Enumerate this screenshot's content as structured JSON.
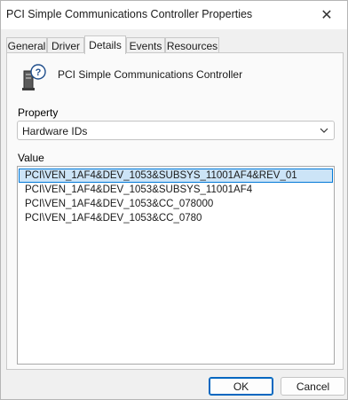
{
  "window": {
    "title": "PCI Simple Communications Controller Properties",
    "close_glyph": "✕"
  },
  "tabs": [
    {
      "label": "General",
      "active": false
    },
    {
      "label": "Driver",
      "active": false
    },
    {
      "label": "Details",
      "active": true
    },
    {
      "label": "Events",
      "active": false
    },
    {
      "label": "Resources",
      "active": false
    }
  ],
  "device": {
    "icon": "unknown-device-icon",
    "name": "PCI Simple Communications Controller"
  },
  "property": {
    "label": "Property",
    "selected": "Hardware IDs"
  },
  "value": {
    "label": "Value",
    "items": [
      "PCI\\VEN_1AF4&DEV_1053&SUBSYS_11001AF4&REV_01",
      "PCI\\VEN_1AF4&DEV_1053&SUBSYS_11001AF4",
      "PCI\\VEN_1AF4&DEV_1053&CC_078000",
      "PCI\\VEN_1AF4&DEV_1053&CC_0780"
    ],
    "selected_index": 0
  },
  "buttons": {
    "ok": "OK",
    "cancel": "Cancel"
  },
  "colors": {
    "selection_fill": "#cce4f7",
    "selection_border": "#0078d7",
    "default_button_border": "#0067c0"
  }
}
